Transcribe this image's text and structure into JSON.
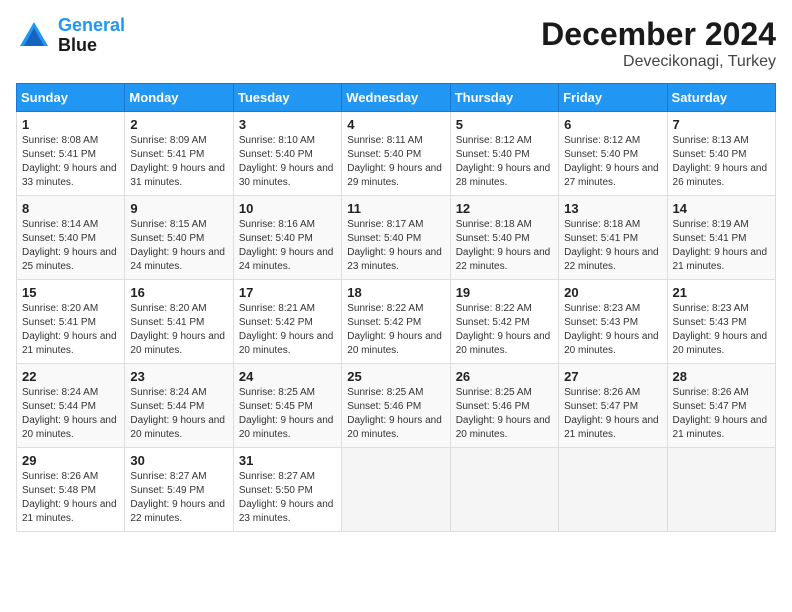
{
  "header": {
    "logo_line1": "General",
    "logo_line2": "Blue",
    "title": "December 2024",
    "subtitle": "Devecikonagi, Turkey"
  },
  "weekdays": [
    "Sunday",
    "Monday",
    "Tuesday",
    "Wednesday",
    "Thursday",
    "Friday",
    "Saturday"
  ],
  "weeks": [
    [
      {
        "day": "1",
        "sunrise": "8:08 AM",
        "sunset": "5:41 PM",
        "daylight": "9 hours and 33 minutes."
      },
      {
        "day": "2",
        "sunrise": "8:09 AM",
        "sunset": "5:41 PM",
        "daylight": "9 hours and 31 minutes."
      },
      {
        "day": "3",
        "sunrise": "8:10 AM",
        "sunset": "5:40 PM",
        "daylight": "9 hours and 30 minutes."
      },
      {
        "day": "4",
        "sunrise": "8:11 AM",
        "sunset": "5:40 PM",
        "daylight": "9 hours and 29 minutes."
      },
      {
        "day": "5",
        "sunrise": "8:12 AM",
        "sunset": "5:40 PM",
        "daylight": "9 hours and 28 minutes."
      },
      {
        "day": "6",
        "sunrise": "8:12 AM",
        "sunset": "5:40 PM",
        "daylight": "9 hours and 27 minutes."
      },
      {
        "day": "7",
        "sunrise": "8:13 AM",
        "sunset": "5:40 PM",
        "daylight": "9 hours and 26 minutes."
      }
    ],
    [
      {
        "day": "8",
        "sunrise": "8:14 AM",
        "sunset": "5:40 PM",
        "daylight": "9 hours and 25 minutes."
      },
      {
        "day": "9",
        "sunrise": "8:15 AM",
        "sunset": "5:40 PM",
        "daylight": "9 hours and 24 minutes."
      },
      {
        "day": "10",
        "sunrise": "8:16 AM",
        "sunset": "5:40 PM",
        "daylight": "9 hours and 24 minutes."
      },
      {
        "day": "11",
        "sunrise": "8:17 AM",
        "sunset": "5:40 PM",
        "daylight": "9 hours and 23 minutes."
      },
      {
        "day": "12",
        "sunrise": "8:18 AM",
        "sunset": "5:40 PM",
        "daylight": "9 hours and 22 minutes."
      },
      {
        "day": "13",
        "sunrise": "8:18 AM",
        "sunset": "5:41 PM",
        "daylight": "9 hours and 22 minutes."
      },
      {
        "day": "14",
        "sunrise": "8:19 AM",
        "sunset": "5:41 PM",
        "daylight": "9 hours and 21 minutes."
      }
    ],
    [
      {
        "day": "15",
        "sunrise": "8:20 AM",
        "sunset": "5:41 PM",
        "daylight": "9 hours and 21 minutes."
      },
      {
        "day": "16",
        "sunrise": "8:20 AM",
        "sunset": "5:41 PM",
        "daylight": "9 hours and 20 minutes."
      },
      {
        "day": "17",
        "sunrise": "8:21 AM",
        "sunset": "5:42 PM",
        "daylight": "9 hours and 20 minutes."
      },
      {
        "day": "18",
        "sunrise": "8:22 AM",
        "sunset": "5:42 PM",
        "daylight": "9 hours and 20 minutes."
      },
      {
        "day": "19",
        "sunrise": "8:22 AM",
        "sunset": "5:42 PM",
        "daylight": "9 hours and 20 minutes."
      },
      {
        "day": "20",
        "sunrise": "8:23 AM",
        "sunset": "5:43 PM",
        "daylight": "9 hours and 20 minutes."
      },
      {
        "day": "21",
        "sunrise": "8:23 AM",
        "sunset": "5:43 PM",
        "daylight": "9 hours and 20 minutes."
      }
    ],
    [
      {
        "day": "22",
        "sunrise": "8:24 AM",
        "sunset": "5:44 PM",
        "daylight": "9 hours and 20 minutes."
      },
      {
        "day": "23",
        "sunrise": "8:24 AM",
        "sunset": "5:44 PM",
        "daylight": "9 hours and 20 minutes."
      },
      {
        "day": "24",
        "sunrise": "8:25 AM",
        "sunset": "5:45 PM",
        "daylight": "9 hours and 20 minutes."
      },
      {
        "day": "25",
        "sunrise": "8:25 AM",
        "sunset": "5:46 PM",
        "daylight": "9 hours and 20 minutes."
      },
      {
        "day": "26",
        "sunrise": "8:25 AM",
        "sunset": "5:46 PM",
        "daylight": "9 hours and 20 minutes."
      },
      {
        "day": "27",
        "sunrise": "8:26 AM",
        "sunset": "5:47 PM",
        "daylight": "9 hours and 21 minutes."
      },
      {
        "day": "28",
        "sunrise": "8:26 AM",
        "sunset": "5:47 PM",
        "daylight": "9 hours and 21 minutes."
      }
    ],
    [
      {
        "day": "29",
        "sunrise": "8:26 AM",
        "sunset": "5:48 PM",
        "daylight": "9 hours and 21 minutes."
      },
      {
        "day": "30",
        "sunrise": "8:27 AM",
        "sunset": "5:49 PM",
        "daylight": "9 hours and 22 minutes."
      },
      {
        "day": "31",
        "sunrise": "8:27 AM",
        "sunset": "5:50 PM",
        "daylight": "9 hours and 23 minutes."
      },
      null,
      null,
      null,
      null
    ]
  ]
}
